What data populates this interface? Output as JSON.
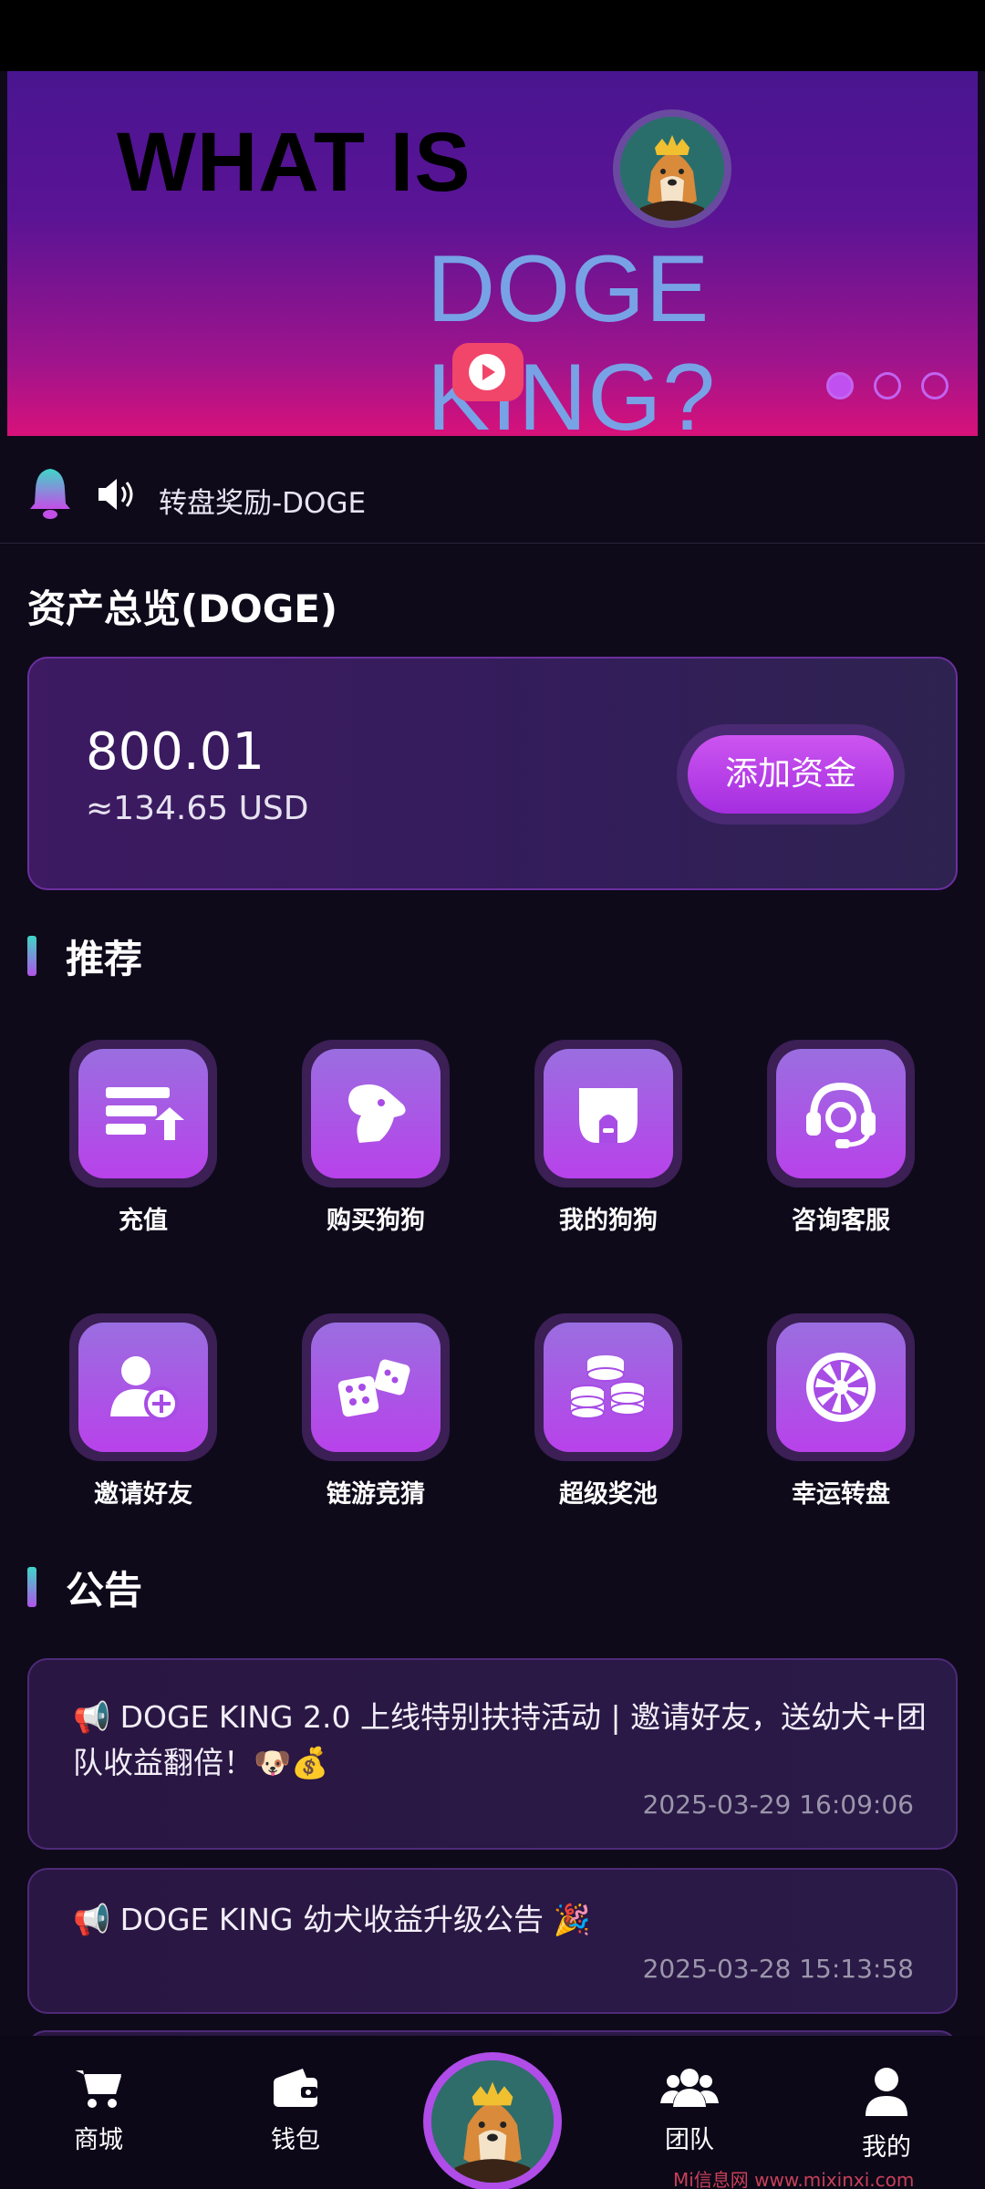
{
  "banner": {
    "title_line1": "WHAT IS",
    "title_line2": "DOGE KING?",
    "avatar_icon": "doge-king-avatar",
    "play_icon": "play-icon",
    "slide_count": 3,
    "active_slide": 1
  },
  "notice": {
    "bell_icon": "bell-icon",
    "speaker_icon": "speaker-icon",
    "text": "转盘奖励-DOGE"
  },
  "assets": {
    "title": "资产总览(DOGE)",
    "balance": "800.01",
    "usd": "≈134.65 USD",
    "add_button": "添加资金"
  },
  "recommend": {
    "title": "推荐",
    "items": [
      {
        "label": "充值",
        "icon": "recharge-icon"
      },
      {
        "label": "购买狗狗",
        "icon": "dog-head-icon"
      },
      {
        "label": "我的狗狗",
        "icon": "doghouse-icon"
      },
      {
        "label": "咨询客服",
        "icon": "headset-icon"
      },
      {
        "label": "邀请好友",
        "icon": "add-user-icon"
      },
      {
        "label": "链游竞猜",
        "icon": "dice-icon"
      },
      {
        "label": "超级奖池",
        "icon": "coins-icon"
      },
      {
        "label": "幸运转盘",
        "icon": "wheel-icon"
      }
    ]
  },
  "announcements": {
    "title": "公告",
    "items": [
      {
        "text": "📢 DOGE KING 2.0 上线特别扶持活动 | 邀请好友，送幼犬+团队收益翻倍！🐶💰",
        "time": "2025-03-29 16:09:06"
      },
      {
        "text": "📢 DOGE KING 幼犬收益升级公告 🎉",
        "time": "2025-03-28 15:13:58"
      }
    ]
  },
  "nav": {
    "items": [
      {
        "label": "商城",
        "icon": "cart-icon"
      },
      {
        "label": "钱包",
        "icon": "wallet-icon"
      },
      {
        "label": "团队",
        "icon": "team-icon"
      },
      {
        "label": "我的",
        "icon": "user-icon"
      }
    ],
    "center_icon": "doge-king-avatar"
  },
  "watermark": "Mi信息网 www.mixinxi.com",
  "colors": {
    "background": "#0e0a1a",
    "accent": "#b842ea",
    "banner_title2": "#78a2e6",
    "play": "#f2456a"
  }
}
